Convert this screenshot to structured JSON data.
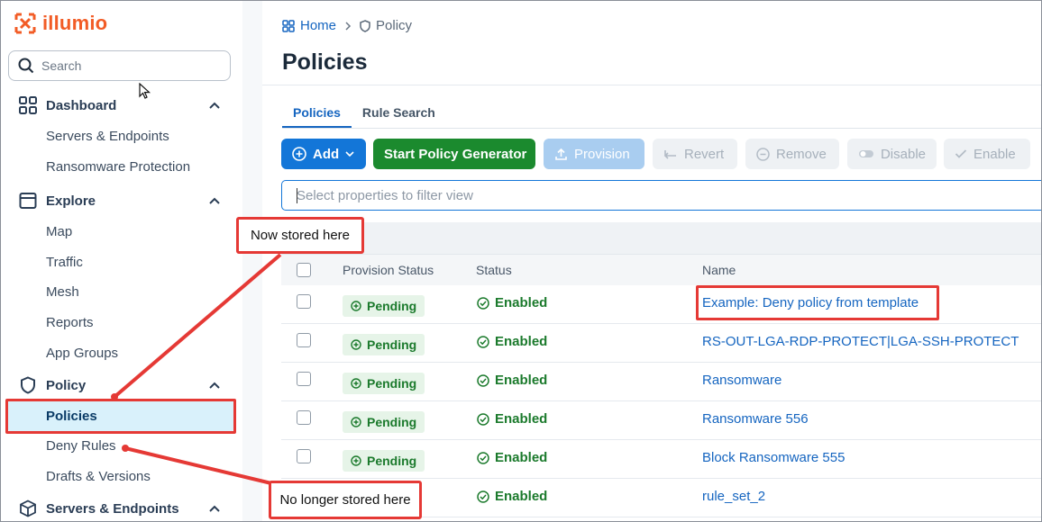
{
  "app": {
    "brand": "illumio",
    "brand_color": "#f25c26"
  },
  "sidebar": {
    "search_placeholder": "Search",
    "groups": [
      {
        "label": "Dashboard",
        "icon": "grid-icon",
        "items": [
          "Servers & Endpoints",
          "Ransomware Protection"
        ]
      },
      {
        "label": "Explore",
        "icon": "archive-icon",
        "items": [
          "Map",
          "Traffic",
          "Mesh",
          "Reports",
          "App Groups"
        ]
      },
      {
        "label": "Policy",
        "icon": "shield-icon",
        "items": [
          "Policies",
          "Deny Rules",
          "Drafts & Versions"
        ]
      },
      {
        "label": "Servers & Endpoints",
        "icon": "cube-icon",
        "items": []
      }
    ],
    "active_item": "Policies"
  },
  "breadcrumb": {
    "home": "Home",
    "current": "Policy"
  },
  "page": {
    "title": "Policies"
  },
  "tabs": [
    "Policies",
    "Rule Search"
  ],
  "toolbar": {
    "add": "Add",
    "generator": "Start Policy Generator",
    "provision": "Provision",
    "revert": "Revert",
    "remove": "Remove",
    "disable": "Disable",
    "enable": "Enable"
  },
  "filter": {
    "placeholder": "Select properties to filter view"
  },
  "table": {
    "columns": [
      "Provision Status",
      "Status",
      "Name"
    ],
    "rows": [
      {
        "provision": "Pending",
        "status": "Enabled",
        "name": "Example: Deny policy from template"
      },
      {
        "provision": "Pending",
        "status": "Enabled",
        "name": "RS-OUT-LGA-RDP-PROTECT|LGA-SSH-PROTECT"
      },
      {
        "provision": "Pending",
        "status": "Enabled",
        "name": "Ransomware"
      },
      {
        "provision": "Pending",
        "status": "Enabled",
        "name": "Ransomware 556"
      },
      {
        "provision": "Pending",
        "status": "Enabled",
        "name": "Block Ransomware 555"
      },
      {
        "provision": "",
        "status": "Enabled",
        "name": "rule_set_2"
      }
    ]
  },
  "annotations": {
    "now_stored": "Now stored here",
    "no_longer_stored": "No longer stored here",
    "color": "#e53935"
  }
}
